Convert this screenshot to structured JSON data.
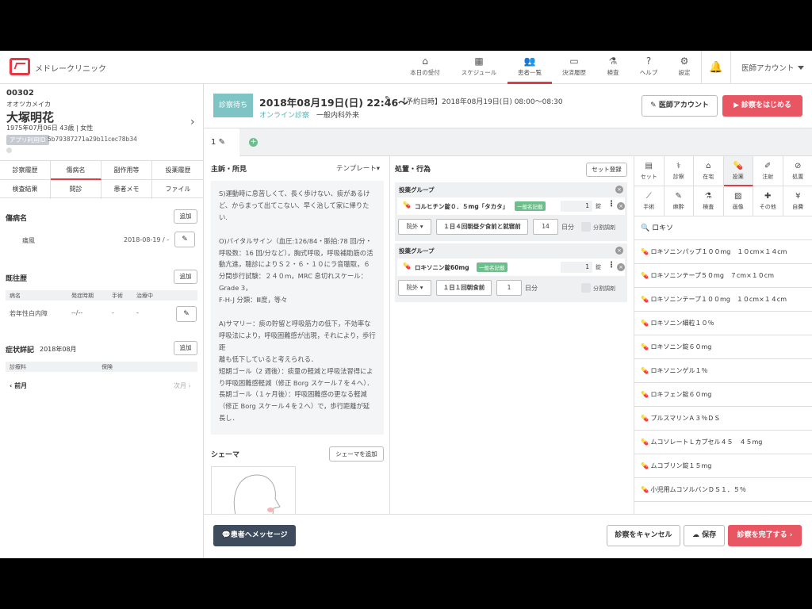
{
  "header": {
    "clinic": "メドレークリニック",
    "nav": [
      {
        "label": "本日の受付",
        "icon": "reception-icon"
      },
      {
        "label": "スケジュール",
        "icon": "calendar-icon"
      },
      {
        "label": "患者一覧",
        "icon": "patients-icon"
      },
      {
        "label": "決済履歴",
        "icon": "card-icon"
      },
      {
        "label": "検査",
        "icon": "microscope-icon"
      },
      {
        "label": "ヘルプ",
        "icon": "help-icon"
      },
      {
        "label": "設定",
        "icon": "gear-icon"
      }
    ],
    "account": "医師アカウント"
  },
  "patient": {
    "id": "00302",
    "kana": "オオツカメイカ",
    "name": "大塚明花",
    "info": "1975年07月06日 43歳 | 女性",
    "app_id_label": "アプリ利用ID",
    "app_id": "5b79387271a29b11cec78b34"
  },
  "left_tabs": [
    "診察履歴",
    "傷病名",
    "副作用等",
    "投薬履歴",
    "検査結果",
    "問診",
    "患者メモ",
    "ファイル"
  ],
  "disease": {
    "title": "傷病名",
    "add": "追加",
    "name": "痛風",
    "date": "2018-08-19 / -"
  },
  "history": {
    "title": "既往歴",
    "add": "追加",
    "cols": [
      "病名",
      "発症時期",
      "手術",
      "治療中"
    ],
    "row": [
      "若年性白内障",
      "--/--",
      "-",
      "-"
    ]
  },
  "symptom": {
    "title": "症状詳記",
    "month": "2018年08月",
    "add": "追加",
    "cols": [
      "診療料",
      "保険"
    ],
    "prev": "前月",
    "next": "次月"
  },
  "visit": {
    "status": "診察待ち",
    "date": "2018年08月19日(日) 22:46〜",
    "scheduled": "【予約日時】2018年08月19日(日) 08:00〜08:30",
    "type": "オンライン診察",
    "dept": "一般内科外来",
    "doctor_btn": "医師アカウント",
    "start_btn": "診察をはじめる",
    "tab": "1"
  },
  "soap": {
    "title": "主訴・所見",
    "template": "テンプレート",
    "text": "S)運動時に息苦しくて、長く歩けない、痰があるけど、からまって出てこない、早く治して家に帰りたい.\n\nO)バイタルサイン（血圧:126/84・脈拍:78 回/分・呼吸数：16 回/分など），胸式呼吸，呼吸補助筋の活動亢進，聴診によりＳ２・６・１０にラ音聴取，６ 分間歩行試験：２４０ｍ，MRC 息切れスケール：Grade 3，\nF-H-J 分類：Ⅲ度，等々\n\nA)サマリー：痰の貯留と呼吸筋力の低下，不効率な呼吸法により，呼吸困難感が出現，それにより，歩行距\n離も低下していると考えられる．\n短期ゴール（2 週後）：痰量の軽減と呼吸法習得により呼吸困難感軽減（修正 Borg スケール７を４へ）．\n長期ゴール（１ヶ月後）：呼吸困難感の更なる軽減（修正 Borg スケール４を２へ）で，歩行距離が延長し．",
    "schema_title": "シェーマ",
    "schema_add": "シェーマを追加"
  },
  "treatment": {
    "title": "処置・行為",
    "set_btn": "セット登録",
    "groups": [
      {
        "title": "投薬グループ",
        "drug": "コルヒチン錠０．５mg「タカタ」",
        "tag": "一般名記載",
        "qty": "1",
        "unit": "錠",
        "place": "院外",
        "usage": "１日４回朝昼夕食前と就寝前",
        "days": "14",
        "days_unit": "日分",
        "split": "分割調剤"
      },
      {
        "title": "投薬グループ",
        "drug": "ロキソニン錠60mg",
        "tag": "一般名記載",
        "qty": "1",
        "unit": "錠",
        "place": "院外",
        "usage": "１日１回朝食前",
        "days": "1",
        "days_unit": "日分",
        "split": "分割調剤"
      }
    ]
  },
  "right": {
    "categories": [
      {
        "label": "セット",
        "icon": "set-icon"
      },
      {
        "label": "診察",
        "icon": "stethoscope-icon"
      },
      {
        "label": "在宅",
        "icon": "home-icon"
      },
      {
        "label": "投薬",
        "icon": "pill-icon"
      },
      {
        "label": "注射",
        "icon": "syringe-icon"
      },
      {
        "label": "処置",
        "icon": "bandage-icon"
      },
      {
        "label": "手術",
        "icon": "scalpel-icon"
      },
      {
        "label": "麻酔",
        "icon": "anesthesia-icon"
      },
      {
        "label": "検査",
        "icon": "microscope-icon"
      },
      {
        "label": "画像",
        "icon": "image-icon"
      },
      {
        "label": "その他",
        "icon": "other-icon"
      },
      {
        "label": "自費",
        "icon": "yen-icon"
      }
    ],
    "search": "ロキソ",
    "items": [
      "ロキソニンパップ１００mg　１０cm×１４cm",
      "ロキソニンテープ５０mg　７cm×１０cm",
      "ロキソニンテープ１００mg　１０cm×１４cm",
      "ロキソニン細粒１０％",
      "ロキソニン錠６０mg",
      "ロキソニンゲル１％",
      "ロキフェン錠６０mg",
      "プルスマリンＡ３％ＤＳ",
      "ムコソレートＬカプセル４５　４５mg",
      "ムコブリン錠１５mg",
      "小児用ムコソルバンＤＳ１．５％"
    ]
  },
  "footer": {
    "message": "患者へメッセージ",
    "cancel": "診察をキャンセル",
    "save": "保存",
    "complete": "診察を完了する"
  }
}
